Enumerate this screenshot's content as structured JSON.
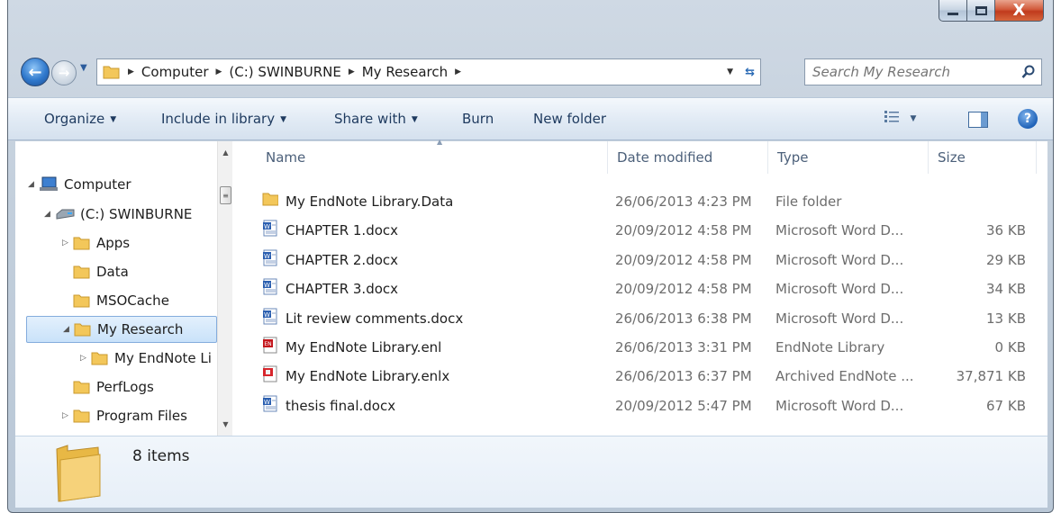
{
  "window": {
    "minimize_glyph": "—",
    "maximize_glyph": "☐",
    "close_glyph": "X"
  },
  "address": {
    "breadcrumbs": [
      "Computer",
      "(C:) SWINBURNE",
      "My Research"
    ],
    "search_placeholder": "Search My Research"
  },
  "toolbar": {
    "organize": "Organize",
    "include_in_library": "Include in library",
    "share_with": "Share with",
    "burn": "Burn",
    "new_folder": "New folder"
  },
  "nav_tree": [
    {
      "label": "Computer",
      "icon": "computer-icon",
      "expanded": true
    },
    {
      "label": "(C:) SWINBURNE",
      "icon": "drive-icon",
      "expanded": true
    },
    {
      "label": "Apps",
      "icon": "folder-icon",
      "expandable": true
    },
    {
      "label": "Data",
      "icon": "folder-icon"
    },
    {
      "label": "MSOCache",
      "icon": "folder-icon"
    },
    {
      "label": "My Research",
      "icon": "folder-icon",
      "expanded": true,
      "selected": true
    },
    {
      "label": "My EndNote Li",
      "icon": "folder-icon",
      "expandable": true
    },
    {
      "label": "PerfLogs",
      "icon": "folder-icon"
    },
    {
      "label": "Program Files",
      "icon": "folder-icon",
      "expandable": true
    }
  ],
  "columns": {
    "name": "Name",
    "date": "Date modified",
    "type": "Type",
    "size": "Size"
  },
  "files": [
    {
      "name": "My EndNote Library.Data",
      "date": "26/06/2013 4:23 PM",
      "type": "File folder",
      "size": "",
      "icon": "folder-icon"
    },
    {
      "name": "CHAPTER 1.docx",
      "date": "20/09/2012 4:58 PM",
      "type": "Microsoft Word D...",
      "size": "36 KB",
      "icon": "word-doc-icon"
    },
    {
      "name": "CHAPTER 2.docx",
      "date": "20/09/2012 4:58 PM",
      "type": "Microsoft Word D...",
      "size": "29 KB",
      "icon": "word-doc-icon"
    },
    {
      "name": "CHAPTER 3.docx",
      "date": "20/09/2012 4:58 PM",
      "type": "Microsoft Word D...",
      "size": "34 KB",
      "icon": "word-doc-icon"
    },
    {
      "name": "Lit review comments.docx",
      "date": "26/06/2013 6:38 PM",
      "type": "Microsoft Word D...",
      "size": "13 KB",
      "icon": "word-doc-icon"
    },
    {
      "name": "My EndNote Library.enl",
      "date": "26/06/2013 3:31 PM",
      "type": "EndNote Library",
      "size": "0 KB",
      "icon": "endnote-library-icon"
    },
    {
      "name": "My EndNote Library.enlx",
      "date": "26/06/2013 6:37 PM",
      "type": "Archived EndNote ...",
      "size": "37,871 KB",
      "icon": "endnote-archive-icon"
    },
    {
      "name": "thesis final.docx",
      "date": "20/09/2012 5:47 PM",
      "type": "Microsoft Word D...",
      "size": "67 KB",
      "icon": "word-doc-icon"
    }
  ],
  "details": {
    "item_count": "8 items"
  },
  "colors": {
    "accent": "#2f78cc",
    "selection_bg": "#c9e2fa",
    "folder_yellow": "#f3c75a"
  }
}
